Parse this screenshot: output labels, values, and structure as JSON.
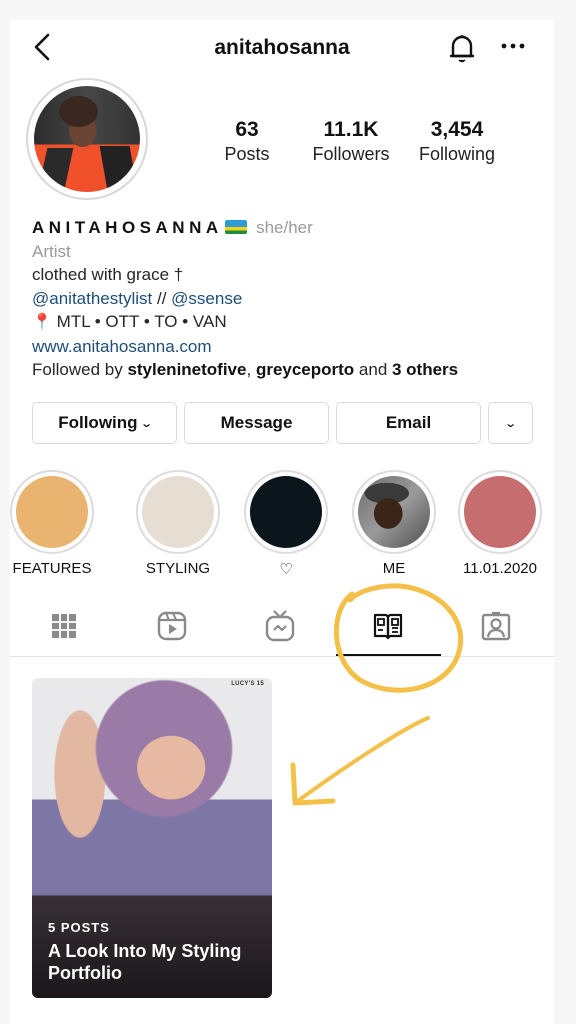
{
  "header": {
    "username": "anitahosanna",
    "back_icon": "chevron-left-icon",
    "bell_icon": "bell-icon",
    "more_icon": "more-horizontal-icon"
  },
  "profile": {
    "stats": [
      {
        "value": "63",
        "label": "Posts"
      },
      {
        "value": "11.1K",
        "label": "Followers"
      },
      {
        "value": "3,454",
        "label": "Following"
      }
    ],
    "display_name": "ANITAHOSANNA",
    "flag_emoji": "rwanda-flag",
    "pronouns": "she/her",
    "category": "Artist",
    "bio_line1": "clothed with grace †",
    "mention1": "@anitathestylist",
    "bio_sep": " // ",
    "mention2": "@ssense",
    "location_pin": "📍",
    "locations": "MTL • OTT • TO • VAN",
    "website": "www.anitahosanna.com",
    "followed_by_prefix": "Followed by ",
    "followed_user1": "styleninetofive",
    "followed_sep": ", ",
    "followed_user2": "greyceporto",
    "followed_and": " and ",
    "followed_others": "3 others"
  },
  "actions": {
    "following": "Following",
    "message": "Message",
    "email": "Email",
    "chevron": "⌄"
  },
  "highlights": [
    {
      "label": "FEATURES",
      "color": "#e8b46f"
    },
    {
      "label": "STYLING",
      "color": "#e7ded3"
    },
    {
      "label": "♡",
      "color": "#0a151c"
    },
    {
      "label": "ME",
      "color": "image"
    },
    {
      "label": "11.01.2020",
      "color": "#c66e6f"
    }
  ],
  "tabs": [
    {
      "name": "grid",
      "icon": "grid-icon",
      "active": false
    },
    {
      "name": "reels",
      "icon": "reels-icon",
      "active": false
    },
    {
      "name": "igtv",
      "icon": "igtv-icon",
      "active": false
    },
    {
      "name": "guides",
      "icon": "guide-icon",
      "active": true
    },
    {
      "name": "tagged",
      "icon": "tagged-icon",
      "active": false
    }
  ],
  "guide": {
    "brand": "LUCY'S 15",
    "post_count": "5 POSTS",
    "title": "A Look Into My Styling Portfolio"
  },
  "annotation": {
    "color": "#f5c04a"
  }
}
